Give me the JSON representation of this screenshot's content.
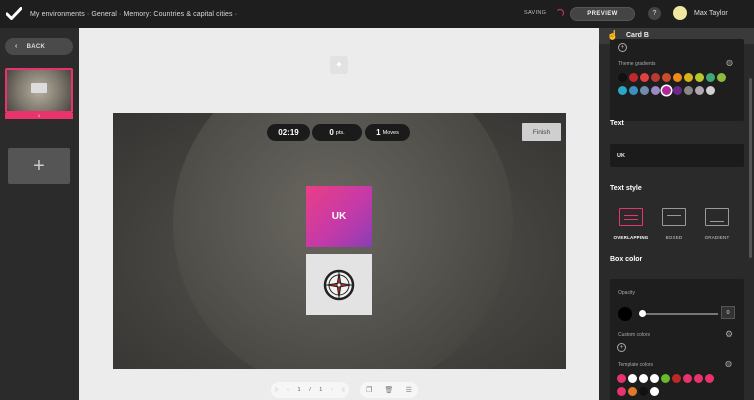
{
  "topbar": {
    "breadcrumb": "My environments · General · Memory: Countries & capital cities ·",
    "saving": "SAVING",
    "preview": "PREVIEW",
    "help": "?",
    "user_name": "Max Taylor"
  },
  "sidebar": {
    "back": "BACK",
    "slide_number": "1"
  },
  "game": {
    "timer": "02:19",
    "points_value": "0",
    "points_unit": "pts.",
    "moves_value": "1",
    "moves_unit": "Moves",
    "finish": "Finish",
    "card_a_text": "UK"
  },
  "pager": {
    "current": "1",
    "separator": "/",
    "total": "1"
  },
  "panel": {
    "header": "Card B",
    "theme_gradients_label": "Theme gradients",
    "text_title": "Text",
    "text_value": "UK",
    "text_style_title": "Text style",
    "styles": [
      "OVERLAPPING",
      "BOXED",
      "GRADIENT"
    ],
    "box_color_title": "Box color",
    "opacity_label": "Opacity",
    "opacity_value": "0",
    "custom_colors_label": "Custom colors",
    "template_colors_label": "Template colors"
  },
  "colors": {
    "accent": "#e8336c",
    "gradient_swatches_row1": [
      "#111111",
      "#c0282c",
      "#e04040",
      "#b83a30",
      "#c94d28",
      "#f08a1c",
      "#d8b41c",
      "#b8c82c",
      "#3ea878",
      "#8cbc3c"
    ],
    "gradient_swatches_row2": [
      "#2aa8c8",
      "#3a90c0",
      "#708ca8",
      "#9a8ac8",
      "#b0289c",
      "#6a2a8c",
      "#888888",
      "#b0a8b0",
      "#d0d0d0"
    ],
    "template_row1": [
      "#e8336c",
      "#ffffff",
      "#ffffff",
      "#ffffff",
      "#6ab82c",
      "#c02828",
      "#e8336c",
      "#e8336c",
      "#e8336c"
    ],
    "template_row2": [
      "#e8336c",
      "#e07a2a",
      "#111111",
      "#ffffff"
    ]
  },
  "icons": {
    "logo": "check-logo-icon",
    "back": "chevron-left-icon",
    "add_slide": "plus-icon",
    "magic": "magic-wand-icon",
    "compass": "compass-icon",
    "copy": "copy-icon",
    "delete": "trash-icon",
    "settings": "gear-icon",
    "palette": "palette-icon"
  }
}
